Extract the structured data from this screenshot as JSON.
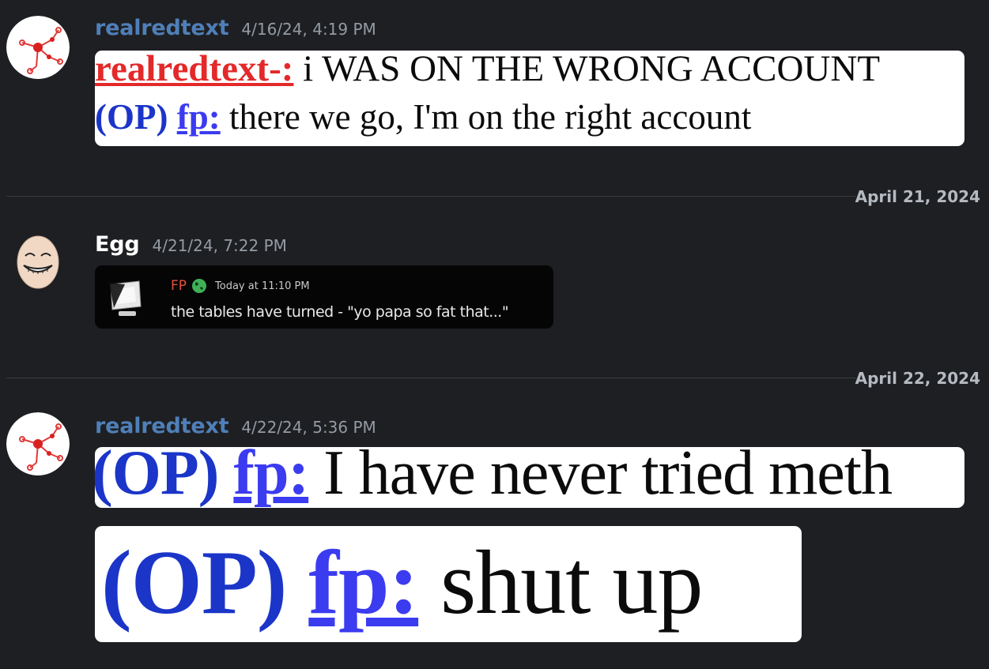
{
  "messages": [
    {
      "username": "realredtext",
      "username_color": "#4f7fb8",
      "timestamp": "4/16/24, 4:19 PM",
      "image": {
        "line1": {
          "name": "realredtext-:",
          "text": " i WAS ON THE WRONG ACCOUNT"
        },
        "line2": {
          "op": "(OP)",
          "name": "fp:",
          "text": " there we go, I'm on the right account"
        }
      }
    },
    {
      "username": "Egg",
      "username_color": "#ffffff",
      "timestamp": "4/21/24, 7:22 PM",
      "embed": {
        "author": "FP",
        "time": "Today at 11:10 PM",
        "text": "the tables have turned - \"yo papa so fat that...\""
      }
    },
    {
      "username": "realredtext",
      "username_color": "#4f7fb8",
      "timestamp": "4/22/24, 5:36 PM",
      "image1": {
        "op": "(OP)",
        "name": "fp:",
        "text": " I have never tried meth"
      },
      "image2": {
        "op": "(OP)",
        "name": "fp:",
        "text": " shut up"
      }
    }
  ],
  "dividers": [
    "April 21, 2024",
    "April 22, 2024"
  ],
  "colors": {
    "background": "#1e1f22",
    "op": "#1b35c9",
    "fp": "#3b3bf0",
    "realredtext_label": "#e3292a"
  },
  "icons": {
    "avatar_realredtext": "red-molecule-avatar",
    "avatar_egg": "trollface-egg-avatar",
    "embed_icon": "computer-monitor-icon",
    "embed_globe": "globe-icon"
  }
}
